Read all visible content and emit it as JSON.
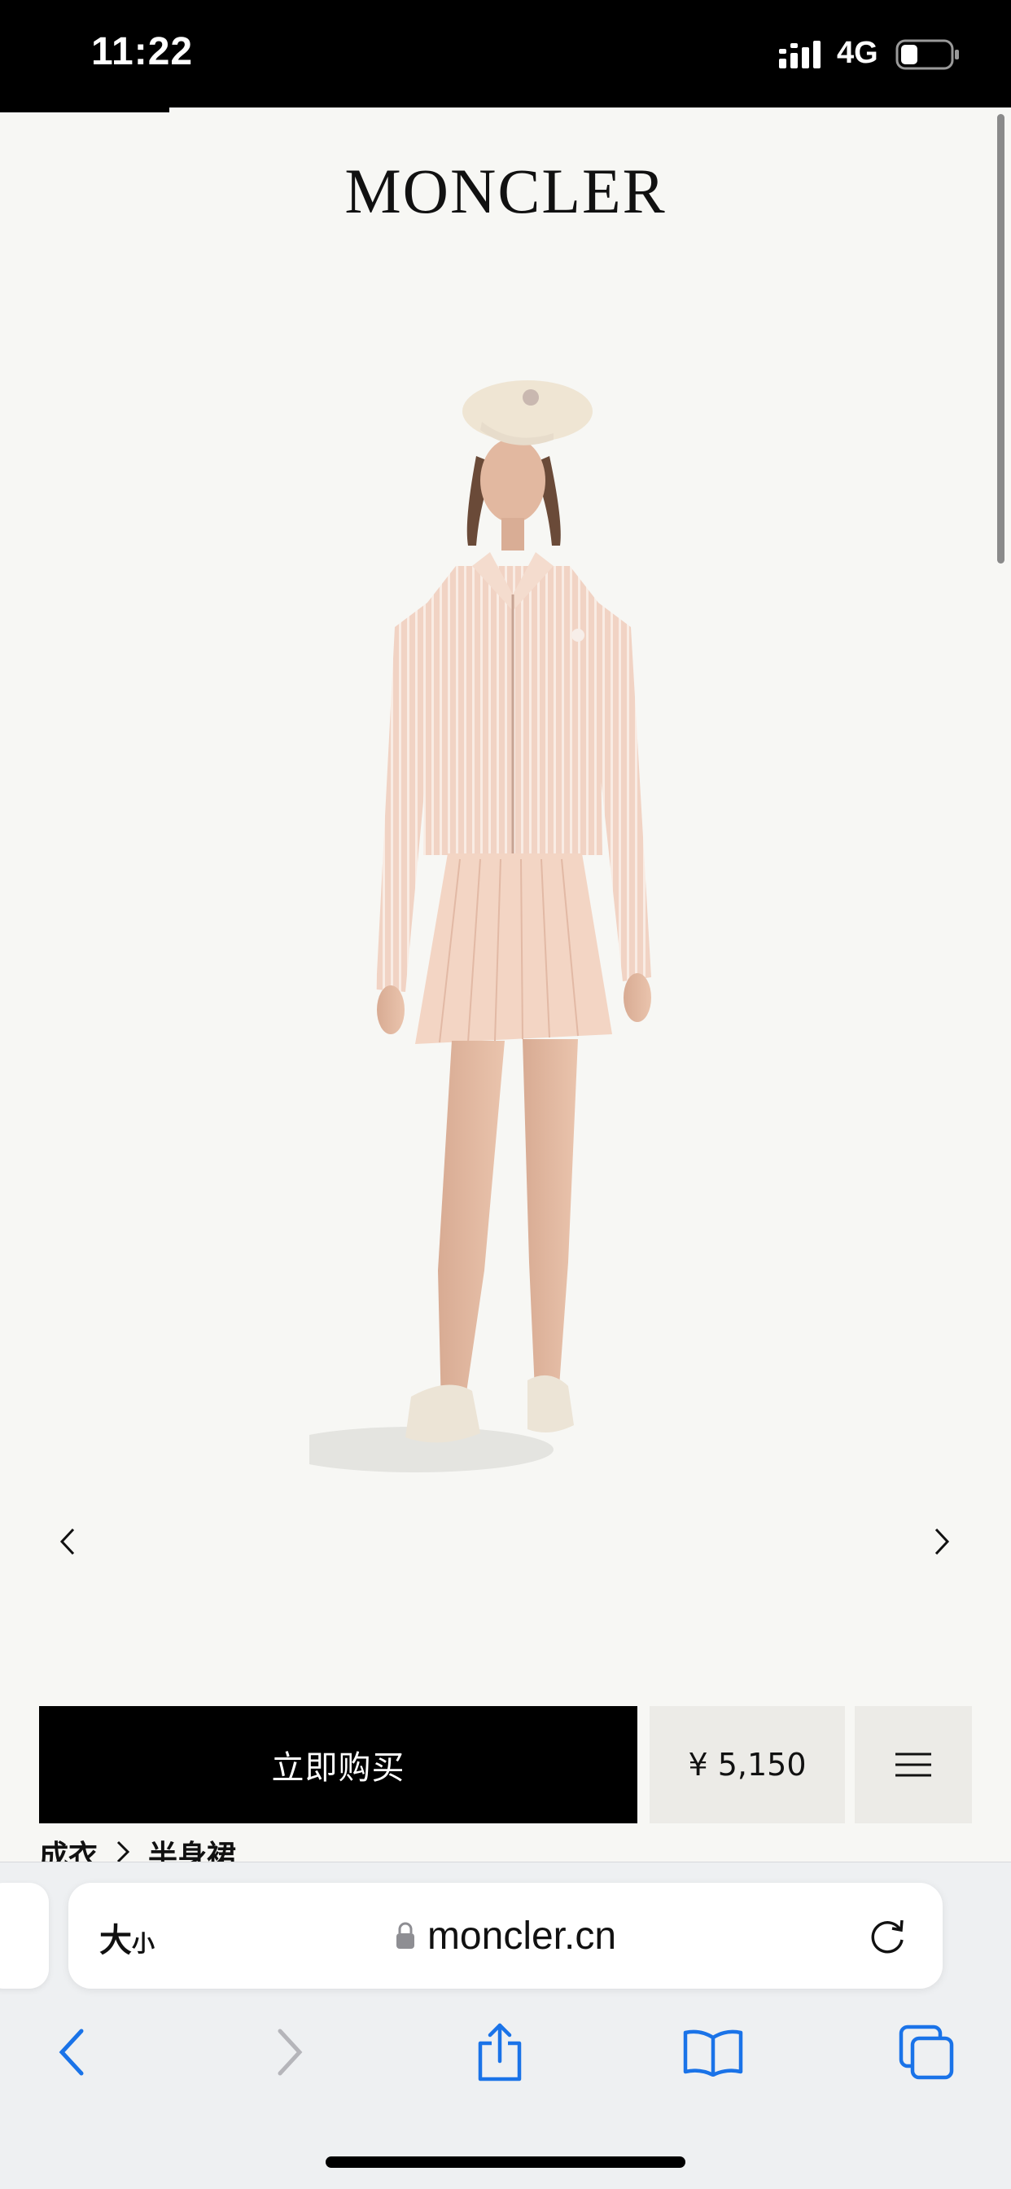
{
  "status_bar": {
    "time": "11:22",
    "network": "4G",
    "icons": [
      "signal-icon",
      "battery-icon"
    ]
  },
  "header": {
    "brand": "MONCLER"
  },
  "product": {
    "image": "product-model-image",
    "carousel_icons": [
      "chevron-left-icon",
      "chevron-right-icon"
    ]
  },
  "purchase_bar": {
    "buy_label": "立即购买",
    "price": "¥ 5,150",
    "menu_icon": "hamburger-menu-icon"
  },
  "breadcrumb": {
    "items": [
      "成衣",
      "半身裙"
    ]
  },
  "browser": {
    "text_size_big": "大",
    "text_size_small": "小",
    "url": "moncler.cn",
    "toolbar_icons": [
      "back-icon",
      "forward-icon",
      "share-icon",
      "bookmarks-icon",
      "tabs-icon"
    ]
  },
  "colors": {
    "page_background": "#f7f7f4",
    "buy_button": "#000000",
    "price_box": "#ecebe7",
    "accent_blue": "#1a73e8"
  }
}
